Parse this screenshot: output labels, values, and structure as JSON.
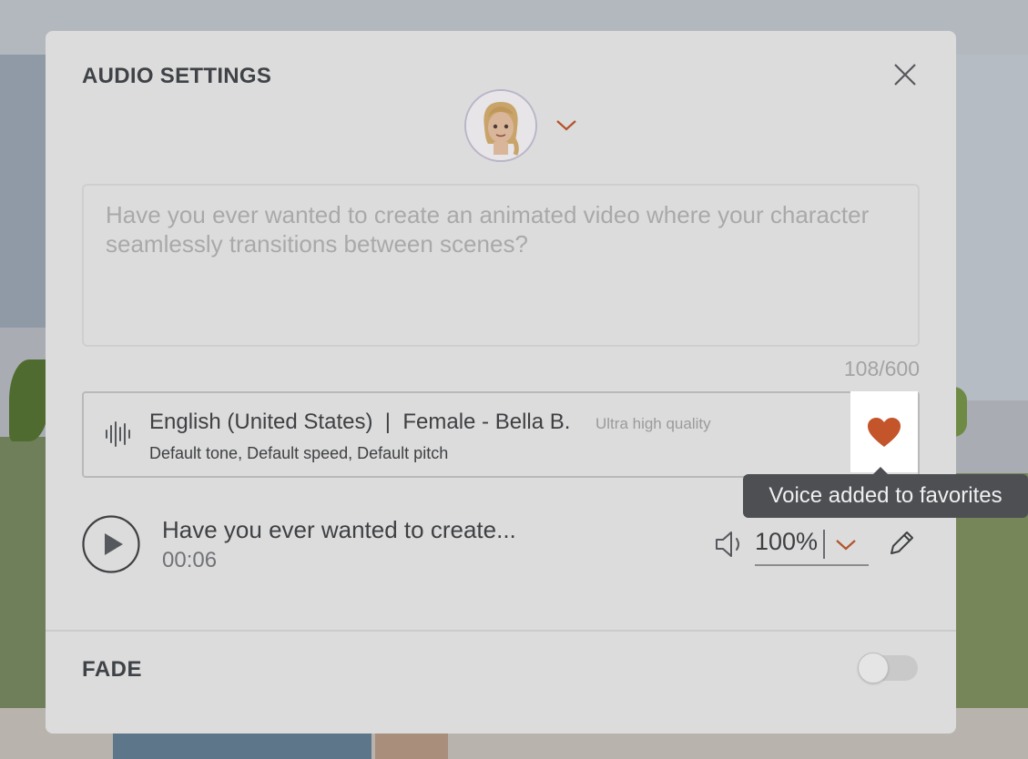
{
  "dialog": {
    "title": "AUDIO SETTINGS",
    "close_icon": "close-icon"
  },
  "character": {
    "avatar_icon": "female-avatar",
    "dropdown_icon": "chevron-down-icon"
  },
  "script": {
    "text": "Have you ever wanted to create an animated video where your character seamlessly transitions between scenes?",
    "char_count": "108/600"
  },
  "voice": {
    "icon": "waveform-icon",
    "name": "English (United States)  |  Female - Bella B.",
    "quality": "Ultra high quality",
    "settings": "Default tone, Default speed, Default pitch",
    "favorite_icon": "heart-icon",
    "favorited": true
  },
  "tooltip": {
    "text": "Voice added to favorites"
  },
  "clip": {
    "play_icon": "play-icon",
    "title": "Have you ever wanted to create...",
    "duration": "00:06"
  },
  "volume": {
    "icon": "speaker-icon",
    "value": "100%",
    "dropdown_icon": "chevron-down-icon",
    "edit_icon": "pencil-icon"
  },
  "fade": {
    "label": "FADE",
    "enabled": false
  },
  "colors": {
    "accent": "#c4542a",
    "overlay_dialog": "#dcdcdc",
    "tooltip_bg": "#4d4f53"
  }
}
